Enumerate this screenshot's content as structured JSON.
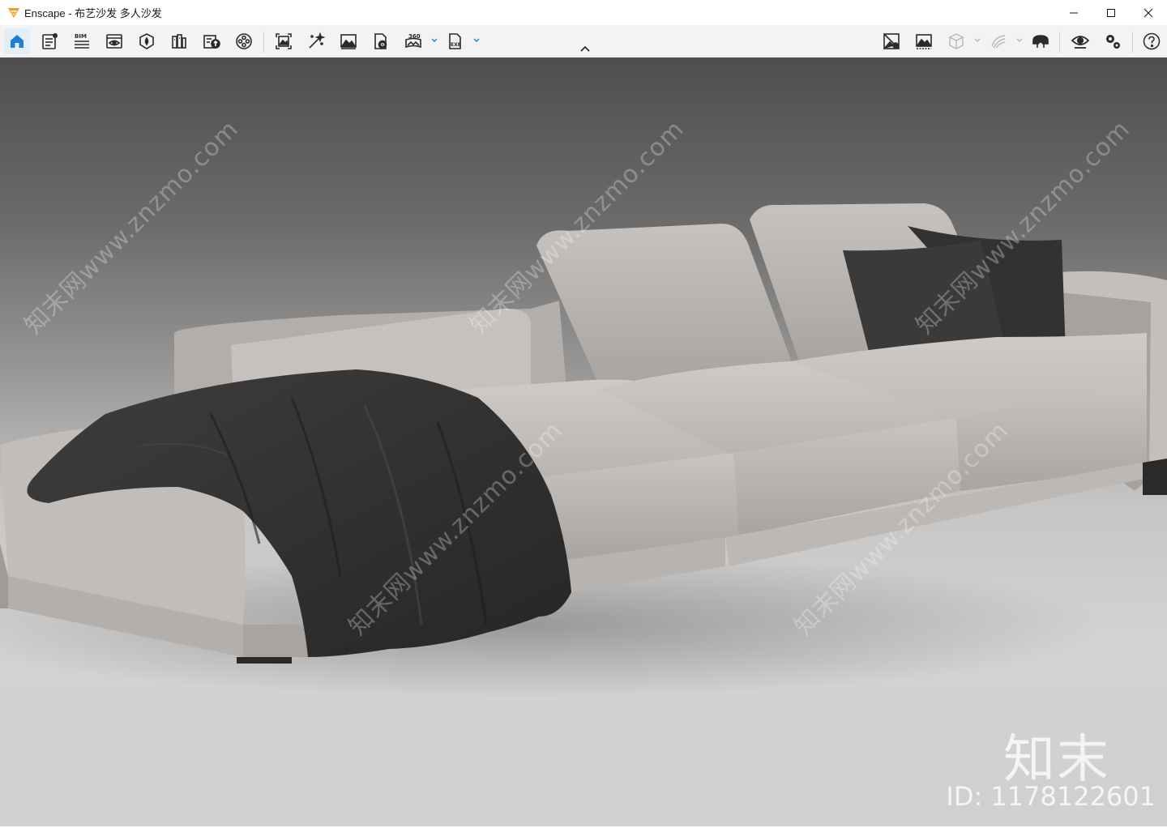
{
  "window": {
    "app_name": "Enscape",
    "separator": " - ",
    "document_title": "布艺沙发 多人沙发"
  },
  "window_controls": [
    {
      "name": "minimize-icon"
    },
    {
      "name": "maximize-icon"
    },
    {
      "name": "close-icon"
    }
  ],
  "toolbar": {
    "bim_label": "BIM",
    "panorama_label": "360",
    "exe_label": "EXE",
    "left_tools": [
      {
        "name": "home-icon",
        "active": true
      },
      {
        "name": "settings-list-icon"
      },
      {
        "name": "bim-icon"
      },
      {
        "name": "view-management-icon"
      },
      {
        "name": "asset-library-icon"
      },
      {
        "name": "material-editor-icon"
      },
      {
        "name": "upload-icon"
      },
      {
        "name": "video-editor-icon"
      },
      {
        "name": "screenshot-icon"
      },
      {
        "name": "batch-render-icon"
      },
      {
        "name": "image-gallery-icon"
      },
      {
        "name": "web-standalone-icon"
      },
      {
        "name": "panorama-360-icon"
      },
      {
        "name": "export-exe-icon"
      }
    ],
    "right_tools": [
      {
        "name": "texture-toggle-icon"
      },
      {
        "name": "grid-image-icon"
      },
      {
        "name": "cube-icon",
        "disabled": true
      },
      {
        "name": "orbit-icon",
        "disabled": true
      },
      {
        "name": "vr-headset-icon"
      },
      {
        "name": "visual-settings-eye-icon"
      },
      {
        "name": "general-settings-icon"
      },
      {
        "name": "help-icon"
      }
    ]
  },
  "viewport": {
    "watermark_text": "知末网www.znzmo.com",
    "brand_mark": "知末",
    "brand_id": "ID: 1178122601"
  },
  "colors": {
    "accent": "#1f7fd6",
    "logo": "#f59a1b",
    "icon": "#2b2b2b",
    "icon_disabled": "#b8b8b8"
  }
}
